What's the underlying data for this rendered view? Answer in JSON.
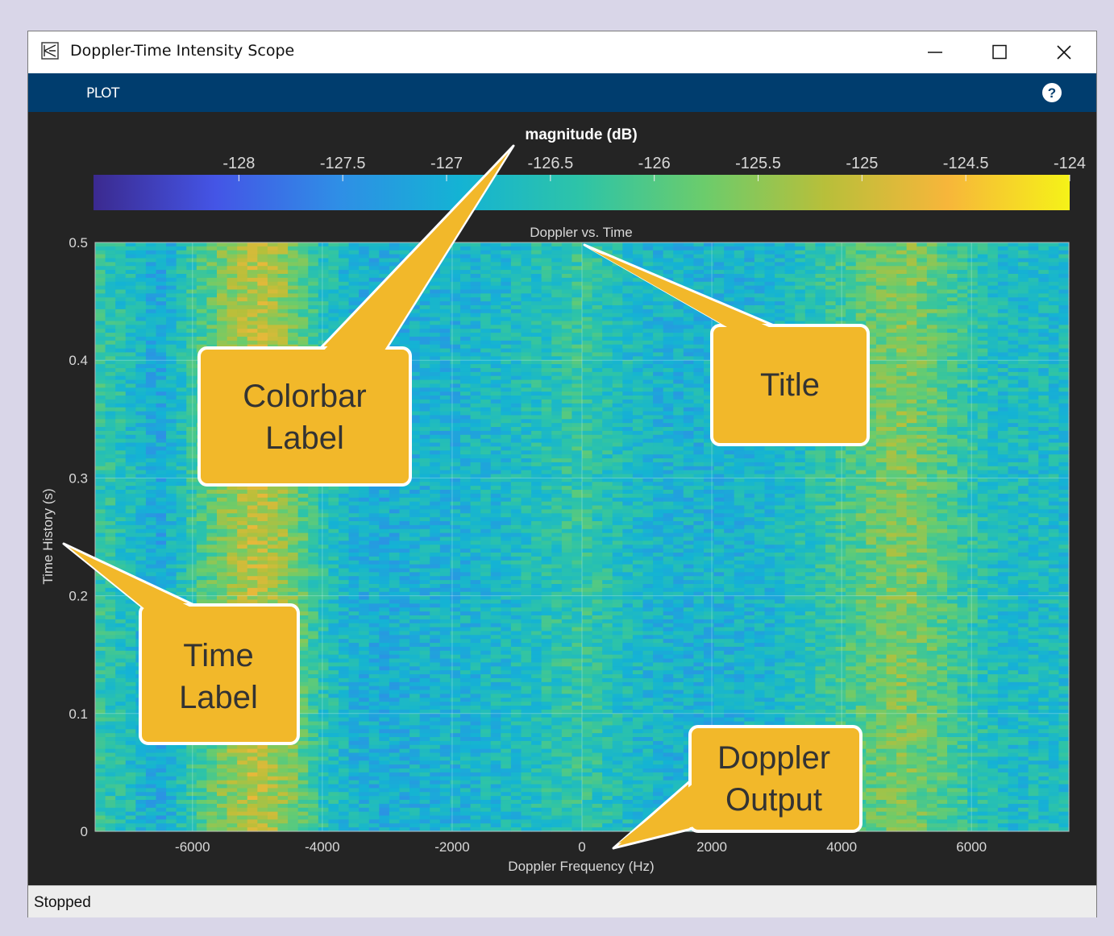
{
  "window": {
    "title": "Doppler-Time Intensity Scope",
    "minimize_label": "minimize",
    "maximize_label": "maximize",
    "close_label": "close"
  },
  "toolstrip": {
    "tab_label": "PLOT",
    "help_icon": "help-icon"
  },
  "colorbar": {
    "label": "magnitude (dB)",
    "ticks": [
      "-128",
      "-127.5",
      "-127",
      "-126.5",
      "-126",
      "-125.5",
      "-125",
      "-124.5",
      "-124"
    ],
    "colormap": [
      "#3b2a8f",
      "#4455e6",
      "#2f8ee6",
      "#14b3d4",
      "#2ec4a7",
      "#6bcc6c",
      "#b8bf3a",
      "#f7b63a",
      "#f5f218"
    ]
  },
  "plot": {
    "title": "Doppler vs. Time",
    "xlabel": "Doppler Frequency (Hz)",
    "ylabel": "Time History (s)",
    "xticks": [
      "-6000",
      "-4000",
      "-2000",
      "0",
      "2000",
      "4000",
      "6000"
    ],
    "yticks": [
      "0",
      "0.1",
      "0.2",
      "0.3",
      "0.4",
      "0.5"
    ]
  },
  "chart_data": {
    "type": "heatmap",
    "title": "Doppler vs. Time",
    "xlabel": "Doppler Frequency (Hz)",
    "ylabel": "Time History (s)",
    "colorbar_label": "magnitude (dB)",
    "xlim": [
      -7500,
      7500
    ],
    "ylim": [
      0,
      0.5
    ],
    "clim": [
      -128.7,
      -124
    ],
    "grid": true,
    "column_profile": {
      "x": [
        -7500,
        -7000,
        -6500,
        -6000,
        -5500,
        -5000,
        -4500,
        -4000,
        -3500,
        -3000,
        -2500,
        -2000,
        -1500,
        -1000,
        -500,
        0,
        500,
        1000,
        1500,
        2000,
        2500,
        3000,
        3500,
        4000,
        4500,
        5000,
        5500,
        6000,
        6500,
        7000,
        7500
      ],
      "magnitude_db": [
        -126.3,
        -126.6,
        -127.1,
        -126.3,
        -125.6,
        -125.1,
        -125.6,
        -126.5,
        -126.9,
        -127.0,
        -126.9,
        -126.9,
        -126.8,
        -126.7,
        -126.5,
        -126.3,
        -126.6,
        -126.8,
        -126.9,
        -126.9,
        -126.9,
        -126.8,
        -126.5,
        -126.2,
        -125.8,
        -125.6,
        -126.0,
        -126.4,
        -126.7,
        -126.7,
        -126.7
      ]
    }
  },
  "callouts": [
    {
      "id": "colorbar-label",
      "text": [
        "Colorbar",
        "Label"
      ]
    },
    {
      "id": "title",
      "text": [
        "Title"
      ]
    },
    {
      "id": "time-label",
      "text": [
        "Time",
        "Label"
      ]
    },
    {
      "id": "doppler-output",
      "text": [
        "Doppler",
        "Output"
      ]
    }
  ],
  "status": {
    "text": "Stopped"
  }
}
